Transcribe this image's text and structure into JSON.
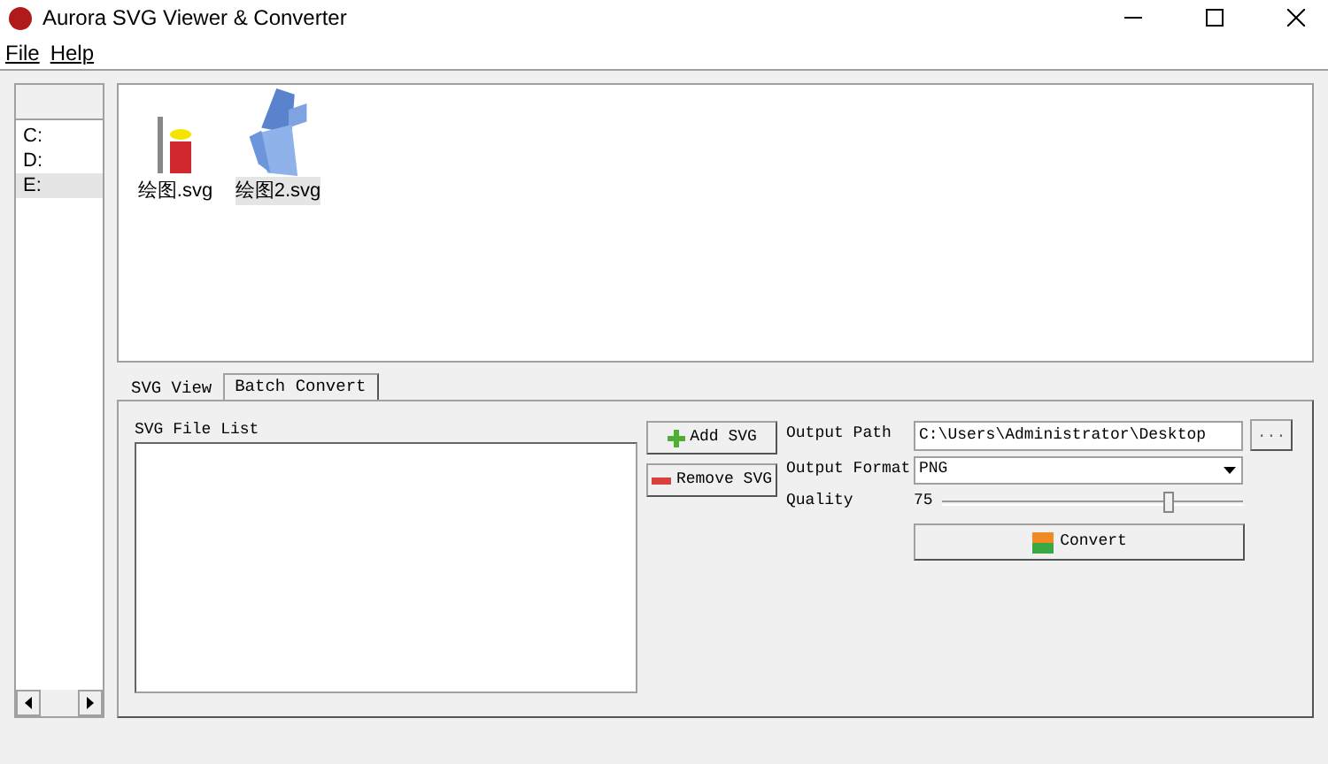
{
  "window": {
    "title": "Aurora SVG Viewer & Converter"
  },
  "menu": [
    "File",
    "Help"
  ],
  "drives": [
    {
      "label": "C:",
      "selected": false
    },
    {
      "label": "D:",
      "selected": false
    },
    {
      "label": "E:",
      "selected": true
    }
  ],
  "files": [
    {
      "name": "绘图.svg",
      "selected": false,
      "kind": "bar"
    },
    {
      "name": "绘图2.svg",
      "selected": true,
      "kind": "shape"
    }
  ],
  "tabs": [
    {
      "label": "SVG View",
      "selected": false
    },
    {
      "label": "Batch Convert",
      "selected": true
    }
  ],
  "batch": {
    "list_label": "SVG File List",
    "add_button": "Add SVG",
    "remove_button": "Remove SVG",
    "output_path_label": "Output Path",
    "output_path": "C:\\Users\\Administrator\\Desktop",
    "browse_button": "...",
    "output_format_label": "Output Format",
    "output_format": "PNG",
    "quality_label": "Quality",
    "quality": "75",
    "quality_slider": {
      "level": 0.75
    },
    "convert_button": "Convert"
  }
}
